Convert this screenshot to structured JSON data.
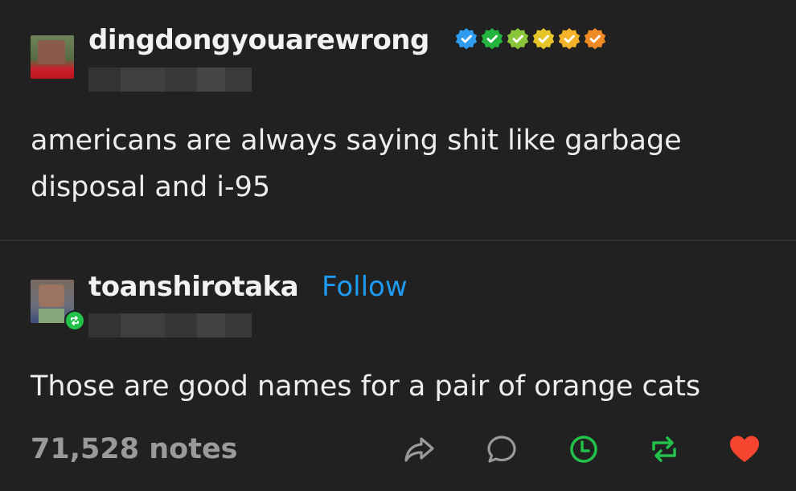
{
  "post1": {
    "username": "dingdongyouarewrong",
    "text": "americans are always saying shit like garbage disposal and i-95",
    "badges": [
      "verified-blue",
      "verified-green",
      "verified-lime",
      "verified-yellow",
      "verified-gold",
      "verified-orange"
    ]
  },
  "post2": {
    "username": "toanshirotaka",
    "follow_label": "Follow",
    "text": "Those are good names for a pair of orange cats"
  },
  "footer": {
    "notes": "71,528 notes"
  },
  "colors": {
    "background": "#212121",
    "follow": "#1e9bf0",
    "reblog": "#21c14a",
    "like": "#f5452e",
    "notes": "#9a9a9a"
  },
  "icons": [
    "share-icon",
    "reply-icon",
    "schedule-icon",
    "reblog-icon",
    "heart-icon"
  ]
}
